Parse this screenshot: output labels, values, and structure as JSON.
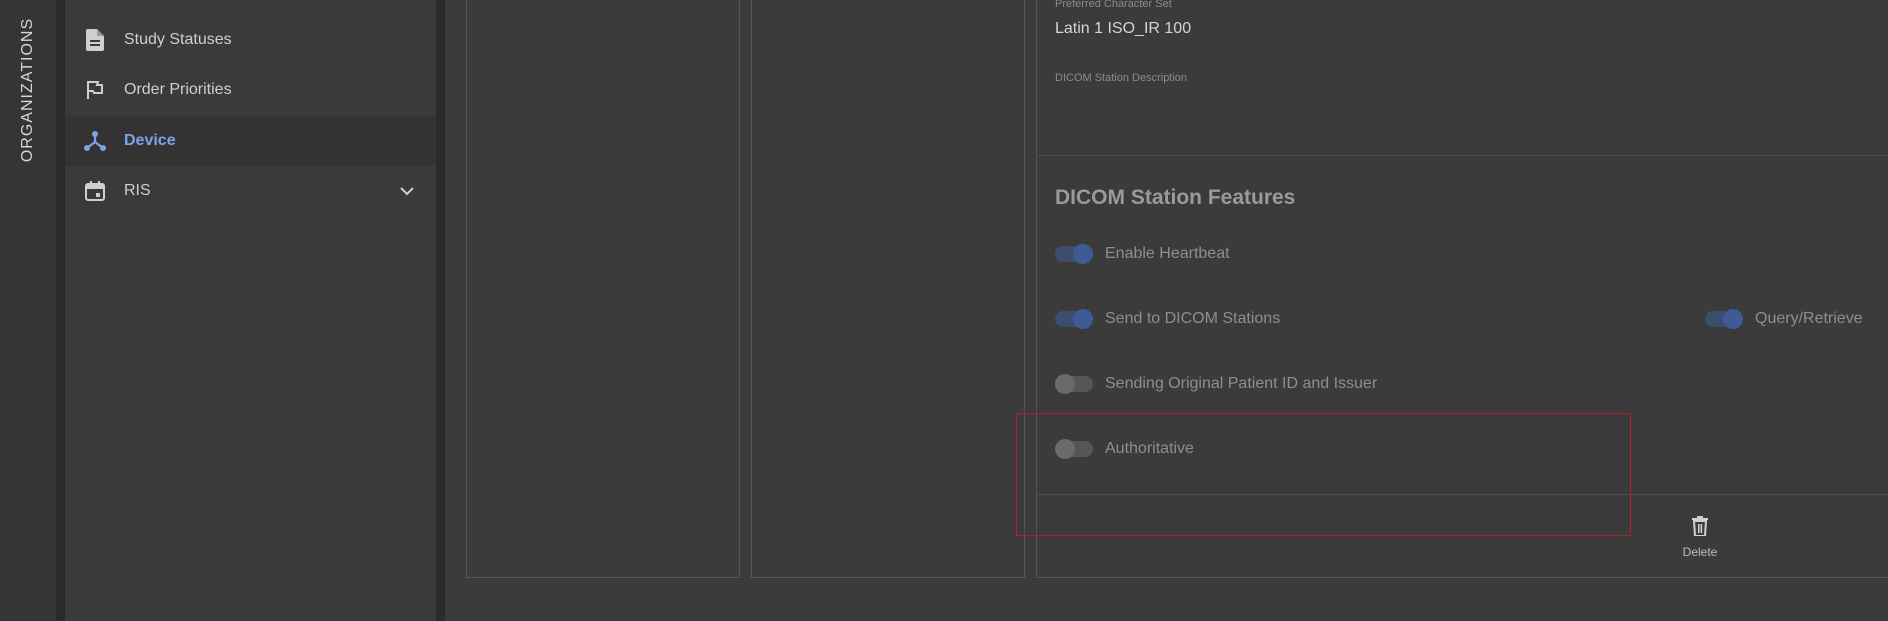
{
  "rail": {
    "label": "ORGANIZATIONS"
  },
  "sidebar": {
    "items": [
      {
        "label": "Study Statuses",
        "icon": "document-icon",
        "active": false
      },
      {
        "label": "Order Priorities",
        "icon": "flag-icon",
        "active": false
      },
      {
        "label": "Device",
        "icon": "device-network-icon",
        "active": true
      },
      {
        "label": "RIS",
        "icon": "calendar-icon",
        "active": false,
        "expandable": true
      }
    ]
  },
  "station": {
    "charset_label": "Preferred Character Set",
    "charset_value": "Latin 1 ISO_IR 100",
    "description_label": "DICOM Station Description",
    "description_value": ""
  },
  "features": {
    "title": "DICOM Station Features",
    "enable_heartbeat": {
      "label": "Enable Heartbeat",
      "on": true
    },
    "send_to_dicom": {
      "label": "Send to DICOM Stations",
      "on": true
    },
    "query_retrieve": {
      "label": "Query/Retrieve",
      "on": true
    },
    "sending_original": {
      "label": "Sending Original Patient ID and Issuer",
      "on": false
    },
    "authoritative": {
      "label": "Authoritative",
      "on": false
    }
  },
  "actions": {
    "delete_label": "Delete"
  },
  "colors": {
    "accent": "#7ea2ea",
    "toggle_on": "#3f5b96",
    "highlight": "#b0232c"
  }
}
